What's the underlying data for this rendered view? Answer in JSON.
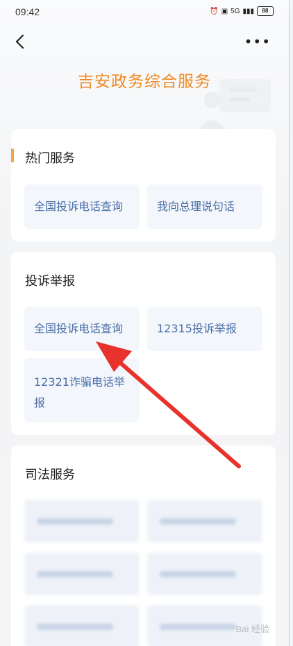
{
  "status": {
    "time": "09:42",
    "network": "5G",
    "battery": "88"
  },
  "page": {
    "title": "吉安政务综合服务"
  },
  "sections": {
    "hot": {
      "title": "热门服务",
      "items": [
        "全国投诉电话查询",
        "我向总理说句话"
      ]
    },
    "complaint": {
      "title": "投诉举报",
      "items": [
        "全国投诉电话查询",
        "12315投诉举报",
        "12321诈骗电话举报"
      ]
    },
    "judicial": {
      "title": "司法服务"
    }
  },
  "colors": {
    "title": "#f08a24",
    "accent": "#f3a448",
    "tile_text": "#4a6fa8",
    "arrow": "#e8322c"
  },
  "watermark": "Bai 经验"
}
